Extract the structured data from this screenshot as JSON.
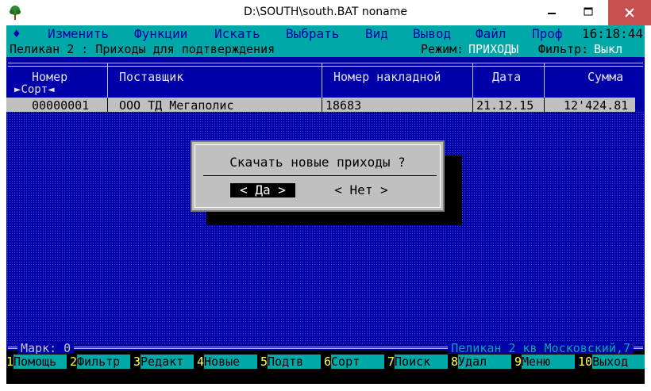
{
  "window": {
    "title": "D:\\SOUTH\\south.BAT noname",
    "icon": "tree-icon"
  },
  "menu": {
    "items": [
      "Изменить",
      "Функции",
      "Искать",
      "Выбрать",
      "Вид",
      "Вывод",
      "Файл",
      "Проф"
    ],
    "clock": "16:18:44"
  },
  "status": {
    "app": "Пеликан 2 : Приходы для подтверждения",
    "mode_label": "Режим:",
    "mode_value": "ПРИХОДЫ",
    "filter_label": "Фильтр:",
    "filter_value": "Выкл"
  },
  "table": {
    "columns": [
      "Номер",
      "Поставщик",
      "Номер накладной",
      "Дата",
      "Сумма"
    ],
    "sort_label": "Сорт",
    "rows": [
      {
        "number": "00000001",
        "supplier": "ООО ТД Мегаполис",
        "invoice": "18683",
        "date": "21.12.15",
        "sum": "12'424.81"
      }
    ]
  },
  "dialog": {
    "message": "Скачать новые приходы ?",
    "yes": "< Да >",
    "no": "< Нет >"
  },
  "footer": {
    "mark": "Марк: 0",
    "company": "Пеликан 2 кв Московский,7"
  },
  "fkeys": [
    {
      "num": "1",
      "label": "Помощь"
    },
    {
      "num": "2",
      "label": "Фильтр"
    },
    {
      "num": "3",
      "label": "Редакт"
    },
    {
      "num": "4",
      "label": "Новые"
    },
    {
      "num": "5",
      "label": "Подтв"
    },
    {
      "num": "6",
      "label": "Сорт"
    },
    {
      "num": "7",
      "label": "Поиск"
    },
    {
      "num": "8",
      "label": "Удал"
    },
    {
      "num": "9",
      "label": "Меню"
    },
    {
      "num": "10",
      "label": "Выход"
    }
  ],
  "colors": {
    "background": "#0000a8",
    "menubar": "#00a8a8",
    "dialog": "#c0c0c0",
    "close_button": "#c75050"
  }
}
